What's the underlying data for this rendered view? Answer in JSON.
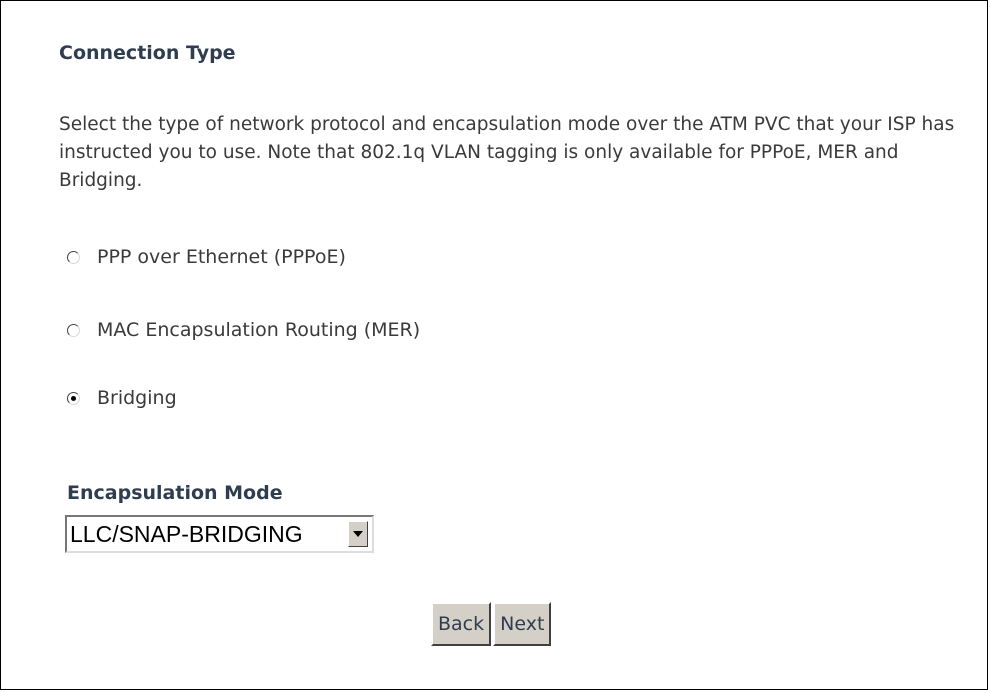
{
  "connection_type": {
    "title": "Connection Type",
    "description": "Select the type of network protocol and encapsulation mode over the ATM PVC that your ISP has instructed you to use. Note that 802.1q VLAN tagging is only available for PPPoE, MER and Bridging.",
    "options": [
      {
        "label": "PPP over Ethernet (PPPoE)",
        "checked": false
      },
      {
        "label": "MAC Encapsulation Routing (MER)",
        "checked": false
      },
      {
        "label": "Bridging",
        "checked": true
      }
    ]
  },
  "encapsulation": {
    "label": "Encapsulation Mode",
    "selected_value": "LLC/SNAP-BRIDGING"
  },
  "buttons": {
    "back_label": "Back",
    "next_label": "Next"
  },
  "colors": {
    "heading": "#303d4f",
    "text": "#3a3a3a",
    "button_face": "#d4d0c8"
  },
  "icons": {
    "select_arrow": "chevron-down-icon"
  }
}
